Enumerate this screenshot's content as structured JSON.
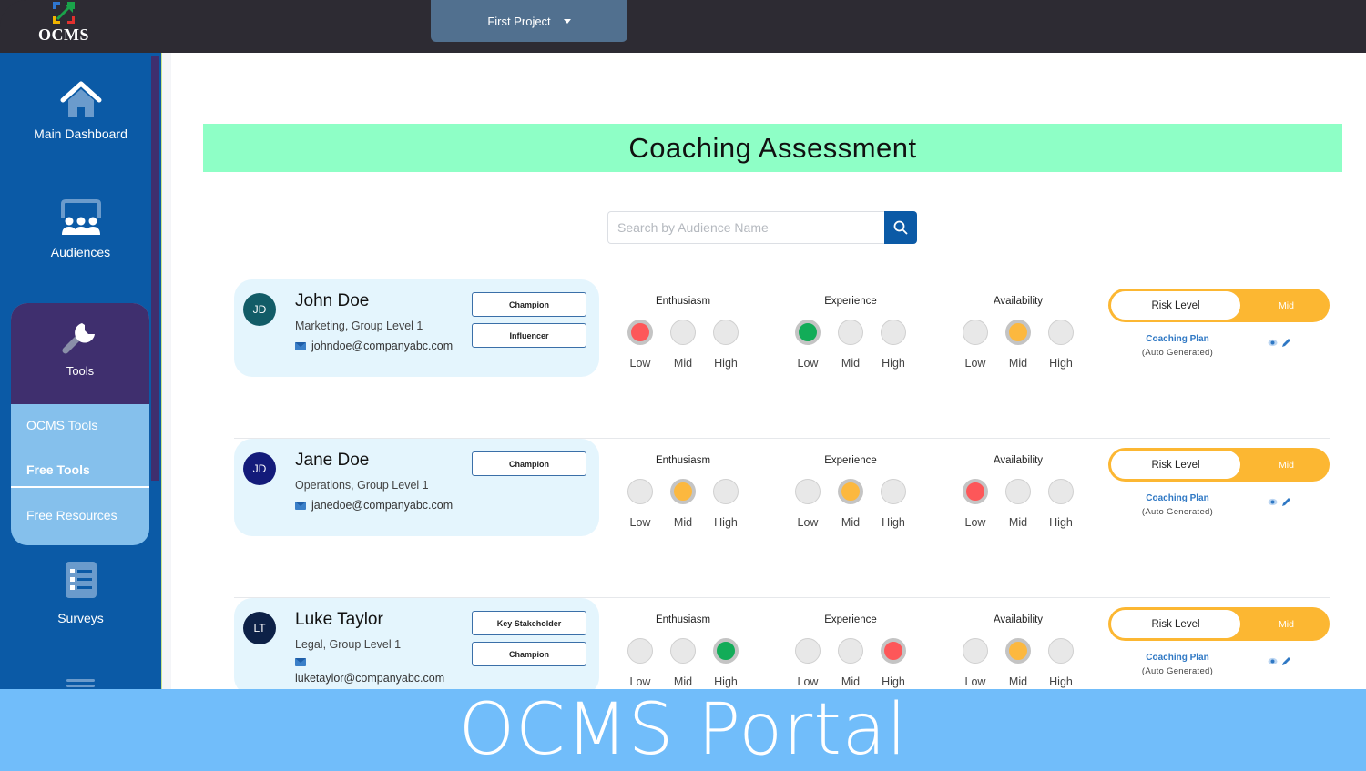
{
  "app": {
    "logo_text": "OCMS"
  },
  "header": {
    "project_selector": "First Project"
  },
  "sidebar": {
    "items": [
      {
        "label": "Main Dashboard",
        "icon": "home-icon"
      },
      {
        "label": "Audiences",
        "icon": "audiences-icon"
      },
      {
        "label": "Tools",
        "icon": "wrench-icon",
        "subitems": [
          {
            "label": "OCMS Tools",
            "active": false
          },
          {
            "label": "Free Tools",
            "active": true
          },
          {
            "label": "Free Resources",
            "active": false
          }
        ]
      },
      {
        "label": "Surveys",
        "icon": "list-icon"
      }
    ]
  },
  "page": {
    "title": "Coaching Assessment",
    "search": {
      "placeholder": "Search by Audience Name",
      "value": ""
    }
  },
  "metric_names": [
    "Enthusiasm",
    "Experience",
    "Availability"
  ],
  "level_labels": [
    "Low",
    "Mid",
    "High"
  ],
  "colors": {
    "Low": "#fd5759",
    "Mid": "#fcb83f",
    "High": "#12ac58",
    "title_banner": "#8effc6",
    "risk": "#fcb732",
    "sidebar": "#0b5aa6",
    "tools_active": "#3f2f6e"
  },
  "audiences": [
    {
      "initials": "JD",
      "avatar_color": "#125c67",
      "name": "John Doe",
      "dept": "Marketing, Group Level 1",
      "email": "johndoe@companyabc.com",
      "tags": [
        "Champion",
        "Influencer"
      ],
      "metrics": {
        "Enthusiasm": "Low",
        "Experience": "Low",
        "Availability": "Mid"
      },
      "metric_colors": {
        "Enthusiasm": "#fd5759",
        "Experience": "#12ac58",
        "Availability": "#fcb83f"
      },
      "risk_label": "Risk Level",
      "risk_value": "Mid",
      "plan_link": "Coaching Plan",
      "plan_sub": "(Auto Generated)"
    },
    {
      "initials": "JD",
      "avatar_color": "#131b7a",
      "name": "Jane Doe",
      "dept": "Operations, Group Level 1",
      "email": "janedoe@companyabc.com",
      "tags": [
        "Champion"
      ],
      "metrics": {
        "Enthusiasm": "Mid",
        "Experience": "Mid",
        "Availability": "Low"
      },
      "metric_colors": {
        "Enthusiasm": "#fcb83f",
        "Experience": "#fcb83f",
        "Availability": "#fd5759"
      },
      "risk_label": "Risk Level",
      "risk_value": "Mid",
      "plan_link": "Coaching Plan",
      "plan_sub": "(Auto Generated)"
    },
    {
      "initials": "LT",
      "avatar_color": "#0d2147",
      "name": "Luke Taylor",
      "dept": "Legal, Group Level 1",
      "email": "luketaylor@companyabc.com",
      "tags": [
        "Key Stakeholder",
        "Champion"
      ],
      "metrics": {
        "Enthusiasm": "High",
        "Experience": "High",
        "Availability": "Mid"
      },
      "metric_colors": {
        "Enthusiasm": "#12ac58",
        "Experience": "#fd5759",
        "Availability": "#fcb83f"
      },
      "risk_label": "Risk Level",
      "risk_value": "Mid",
      "plan_link": "Coaching Plan",
      "plan_sub": "(Auto Generated)"
    }
  ],
  "footer": {
    "banner_text": "OCMS Portal"
  }
}
